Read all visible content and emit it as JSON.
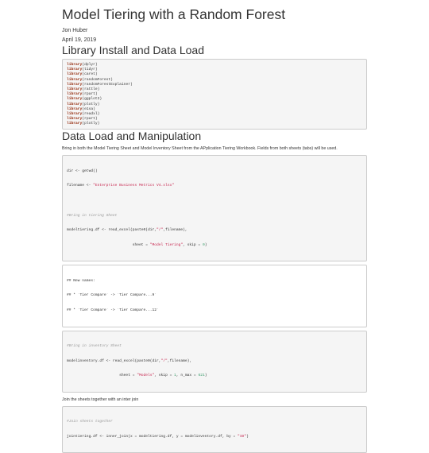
{
  "header": {
    "title": "Model Tiering with a Random Forest",
    "author": "Jon Huber",
    "date": "April 19, 2019"
  },
  "section1": {
    "heading": "Library Install and Data Load",
    "libraries": [
      "dplyr",
      "tidyr",
      "caret",
      "randomForest",
      "randomForestExplainer",
      "rattle",
      "rpart",
      "ggplot2",
      "plotly",
      "e1sa",
      "readxl",
      "rpart",
      "plotly"
    ],
    "library_keyword": "library"
  },
  "section2": {
    "heading": "Data Load and Manipulation",
    "intro": "Bring in both the Model Tiering Sheet and Model Inventory Sheet from the APplication Tiering Workbook. Fields from both sheets (tabs) will be used.",
    "block1": {
      "l1_a": "dir <- getwd()",
      "l2_a": "filename <- ",
      "l2_s": "\"Enterprise Business Metrics V4.xlsx\"",
      "l3_c": "#Bring in tiering Sheet",
      "l4_a": "modeltiering.df <- read_excel(paste0(dir,",
      "l4_s": "\"/\"",
      "l4_b": ",filename),",
      "l5_a": "                              sheet = ",
      "l5_s": "\"Model Tiering\"",
      "l5_b": ", skip = ",
      "l5_n": "0",
      "l5_c": ")"
    },
    "block2": {
      "l1": "## New names:",
      "l2": "## * `Tier Compare` -> `Tier Compare...9`",
      "l3": "## * `Tier Compare` -> `Tier Compare...12`"
    },
    "block3": {
      "l1_c": "#Bring in inventory Sheet",
      "l2_a": "modelinventory.df <- read_excel(paste0(dir,",
      "l2_s": "\"/\"",
      "l2_b": ",filename),",
      "l3_a": "                        sheet = ",
      "l3_s": "\"Models\"",
      "l3_b": ", skip = ",
      "l3_n1": "1",
      "l3_c": ", n_max = ",
      "l3_n2": "621",
      "l3_d": ")"
    },
    "join_text": "Join the sheets together with an inter join",
    "block4": {
      "l1_c": "#Join sheets together",
      "l2_a": "jointiering.df <- inner_join(x = modeltiering.df, y = modelinventory.df, by = ",
      "l2_s": "\"ID\"",
      "l2_b": ")"
    }
  }
}
